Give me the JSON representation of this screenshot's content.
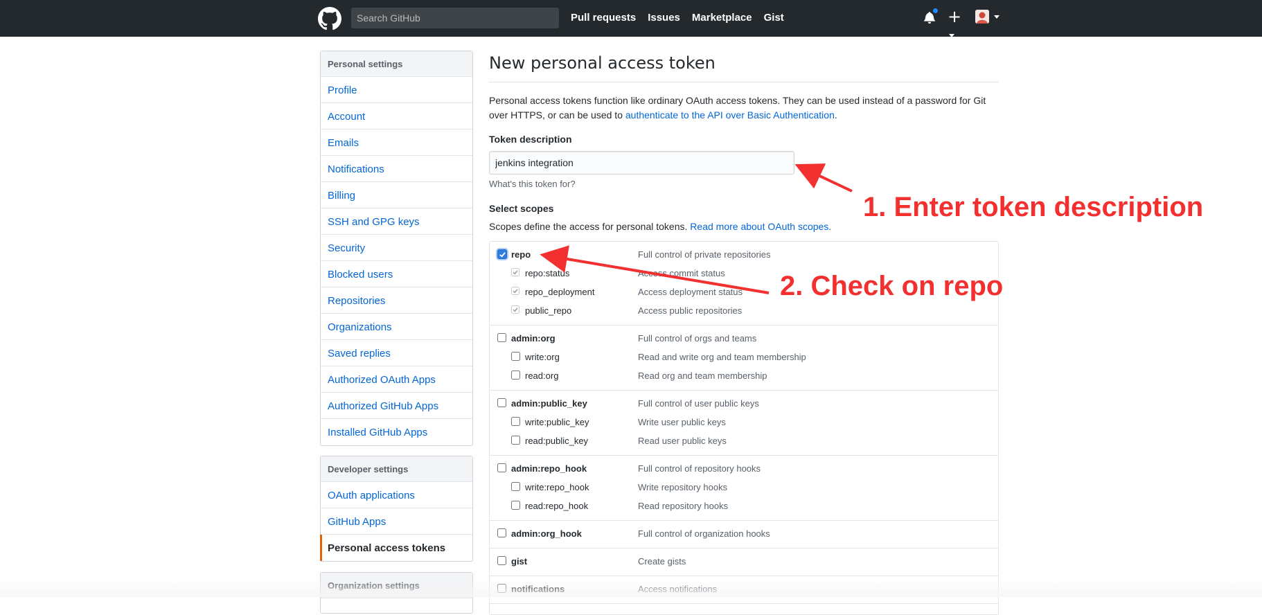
{
  "header": {
    "search_placeholder": "Search GitHub",
    "nav": [
      "Pull requests",
      "Issues",
      "Marketplace",
      "Gist"
    ],
    "icons": [
      "github-logo-icon",
      "bell-icon",
      "plus-icon",
      "avatar"
    ],
    "notification_color": "#2188ff"
  },
  "sidebar": {
    "personal": {
      "heading": "Personal settings",
      "items": [
        "Profile",
        "Account",
        "Emails",
        "Notifications",
        "Billing",
        "SSH and GPG keys",
        "Security",
        "Blocked users",
        "Repositories",
        "Organizations",
        "Saved replies",
        "Authorized OAuth Apps",
        "Authorized GitHub Apps",
        "Installed GitHub Apps"
      ]
    },
    "developer": {
      "heading": "Developer settings",
      "items": [
        "OAuth applications",
        "GitHub Apps",
        "Personal access tokens"
      ],
      "selected": "Personal access tokens"
    },
    "organization": {
      "heading": "Organization settings"
    }
  },
  "main": {
    "title": "New personal access token",
    "intro_text": "Personal access tokens function like ordinary OAuth access tokens. They can be used instead of a password for Git over HTTPS, or can be used to",
    "intro_link": "authenticate to the API over Basic Authentication",
    "intro_end": ".",
    "token_label": "Token description",
    "token_value": "jenkins integration",
    "token_note": "What's this token for?",
    "scopes_label": "Select scopes",
    "scopes_desc": "Scopes define the access for personal tokens.",
    "scopes_link": "Read more about OAuth scopes.",
    "scopes": [
      {
        "name": "repo",
        "desc": "Full control of private repositories",
        "checked": true,
        "children": [
          {
            "name": "repo:status",
            "desc": "Access commit status",
            "checked": true
          },
          {
            "name": "repo_deployment",
            "desc": "Access deployment status",
            "checked": true
          },
          {
            "name": "public_repo",
            "desc": "Access public repositories",
            "checked": true
          }
        ]
      },
      {
        "name": "admin:org",
        "desc": "Full control of orgs and teams",
        "checked": false,
        "children": [
          {
            "name": "write:org",
            "desc": "Read and write org and team membership",
            "checked": false
          },
          {
            "name": "read:org",
            "desc": "Read org and team membership",
            "checked": false
          }
        ]
      },
      {
        "name": "admin:public_key",
        "desc": "Full control of user public keys",
        "checked": false,
        "children": [
          {
            "name": "write:public_key",
            "desc": "Write user public keys",
            "checked": false
          },
          {
            "name": "read:public_key",
            "desc": "Read user public keys",
            "checked": false
          }
        ]
      },
      {
        "name": "admin:repo_hook",
        "desc": "Full control of repository hooks",
        "checked": false,
        "children": [
          {
            "name": "write:repo_hook",
            "desc": "Write repository hooks",
            "checked": false
          },
          {
            "name": "read:repo_hook",
            "desc": "Read repository hooks",
            "checked": false
          }
        ]
      },
      {
        "name": "admin:org_hook",
        "desc": "Full control of organization hooks",
        "checked": false,
        "children": []
      },
      {
        "name": "gist",
        "desc": "Create gists",
        "checked": false,
        "children": []
      },
      {
        "name": "notifications",
        "desc": "Access notifications",
        "checked": false,
        "children": []
      }
    ]
  },
  "annotations": {
    "step1": "1. Enter token description",
    "step2": "2. Check on repo",
    "color": "#f33030"
  }
}
